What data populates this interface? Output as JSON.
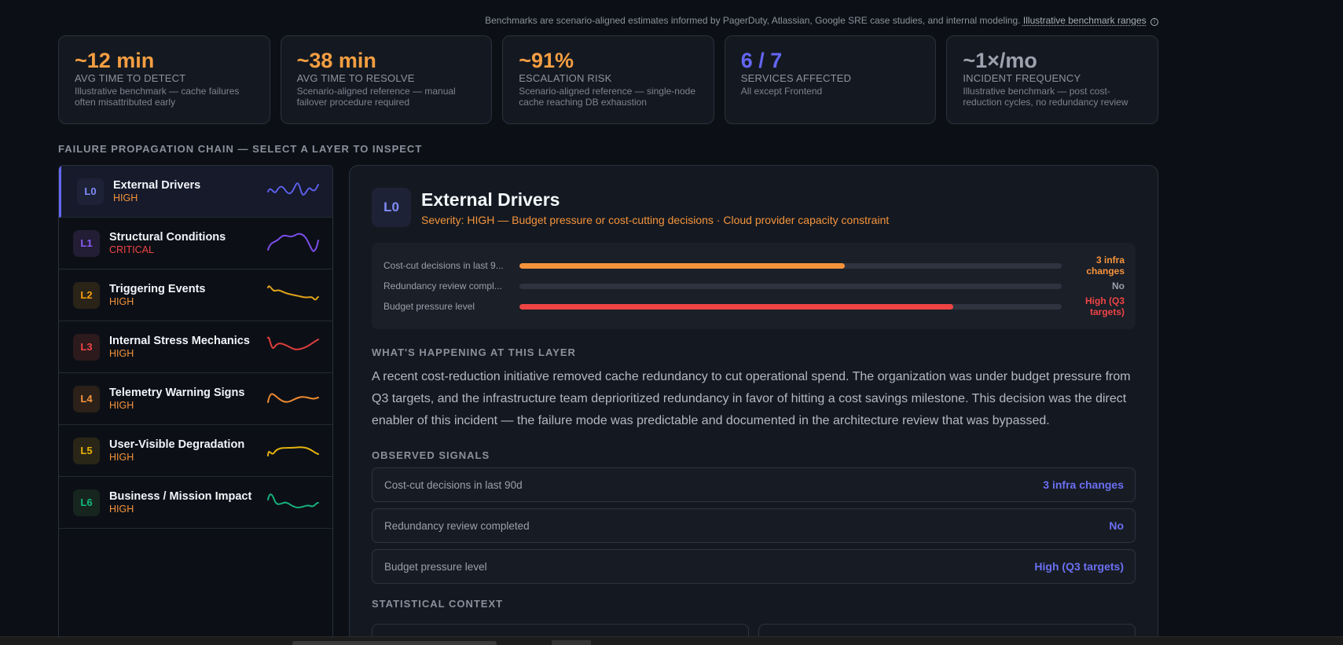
{
  "header": {
    "note": "Benchmarks are scenario-aligned estimates informed by PagerDuty, Atlassian, Google SRE case studies, and internal modeling.",
    "note_link": "Illustrative benchmark ranges",
    "info_icon": "i"
  },
  "kpis": [
    {
      "value": "~12 min",
      "label": "AVG TIME TO DETECT",
      "desc": "Illustrative benchmark — cache failures often misattributed early",
      "color": "#f59e42"
    },
    {
      "value": "~38 min",
      "label": "AVG TIME TO RESOLVE",
      "desc": "Scenario-aligned reference — manual failover procedure required",
      "color": "#f59e42"
    },
    {
      "value": "~91%",
      "label": "ESCALATION RISK",
      "desc": "Scenario-aligned reference — single-node cache reaching DB exhaustion",
      "color": "#f59e42"
    },
    {
      "value": "6 / 7",
      "label": "SERVICES AFFECTED",
      "desc": "All except Frontend",
      "color": "#6366f1"
    },
    {
      "value": "~1×/mo",
      "label": "INCIDENT FREQUENCY",
      "desc": "Illustrative benchmark — post cost-reduction cycles, no redundancy review",
      "color": "#9ca3af"
    }
  ],
  "chain": {
    "section_label": "FAILURE PROPAGATION CHAIN — SELECT A LAYER TO INSPECT",
    "layers": [
      {
        "id": "L0",
        "name": "External Drivers",
        "severity": "HIGH",
        "sev_color": "#f5933c",
        "badge_bg": "#1d2237",
        "badge_fg": "#818cf8",
        "spark_color": "#5b5fe8"
      },
      {
        "id": "L1",
        "name": "Structural Conditions",
        "severity": "CRITICAL",
        "sev_color": "#ef4444",
        "badge_bg": "#231d35",
        "badge_fg": "#8b5cf6",
        "spark_color": "#7c4dea"
      },
      {
        "id": "L2",
        "name": "Triggering Events",
        "severity": "HIGH",
        "sev_color": "#f5933c",
        "badge_bg": "#2a2318",
        "badge_fg": "#f59e0b",
        "spark_color": "#e0a21a"
      },
      {
        "id": "L3",
        "name": "Internal Stress Mechanics",
        "severity": "HIGH",
        "sev_color": "#f5933c",
        "badge_bg": "#2c1a1c",
        "badge_fg": "#ef4444",
        "spark_color": "#e03e3e"
      },
      {
        "id": "L4",
        "name": "Telemetry Warning Signs",
        "severity": "HIGH",
        "sev_color": "#f5933c",
        "badge_bg": "#2b2119",
        "badge_fg": "#f5933c",
        "spark_color": "#ef8a30"
      },
      {
        "id": "L5",
        "name": "User-Visible Degradation",
        "severity": "HIGH",
        "sev_color": "#f5933c",
        "badge_bg": "#2a2617",
        "badge_fg": "#eab308",
        "spark_color": "#e6b30f"
      },
      {
        "id": "L6",
        "name": "Business / Mission Impact",
        "severity": "HIGH",
        "sev_color": "#f5933c",
        "badge_bg": "#16261f",
        "badge_fg": "#10b981",
        "spark_color": "#17b07c"
      }
    ]
  },
  "detail": {
    "badge": "L0",
    "title": "External Drivers",
    "subtitle": "Severity: HIGH — Budget pressure or cost-cutting decisions · Cloud provider capacity constraint",
    "bars": [
      {
        "label": "Cost-cut decisions in last 9...",
        "value": "3 infra changes",
        "fill": 0.6,
        "color": "#f5933c"
      },
      {
        "label": "Redundancy review compl...",
        "value": "No",
        "fill": 0,
        "color": "#9aa0ab"
      },
      {
        "label": "Budget pressure level",
        "value": "High (Q3 targets)",
        "fill": 0.8,
        "color": "#ef4444"
      }
    ],
    "happening_heading": "WHAT'S HAPPENING AT THIS LAYER",
    "happening_text": "A recent cost-reduction initiative removed cache redundancy to cut operational spend. The organization was under budget pressure from Q3 targets, and the infrastructure team deprioritized redundancy in favor of hitting a cost savings milestone. This decision was the direct enabler of this incident — the failure mode was predictable and documented in the architecture review that was bypassed.",
    "signals_heading": "OBSERVED SIGNALS",
    "signals": [
      {
        "label": "Cost-cut decisions in last 90d",
        "value": "3 infra changes"
      },
      {
        "label": "Redundancy review completed",
        "value": "No"
      },
      {
        "label": "Budget pressure level",
        "value": "High (Q3 targets)"
      }
    ],
    "stat_heading": "STATISTICAL CONTEXT"
  }
}
